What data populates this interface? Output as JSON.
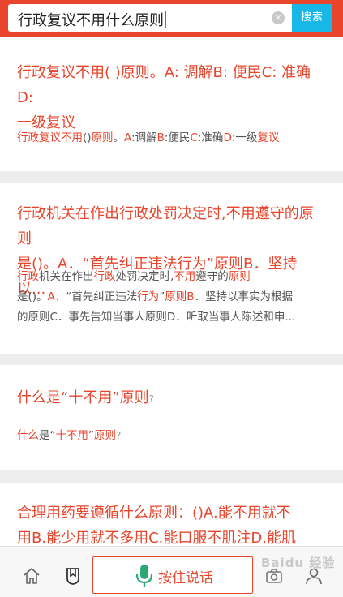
{
  "search": {
    "query": "行政复议不用什么原则",
    "button_label": "搜索",
    "clear_glyph": "×"
  },
  "results": [
    {
      "title_line1": "行政复议不用( )原则。A: 调解B: 便民C: 准确D:",
      "title_line2": "一级复议",
      "snippet": [
        {
          "t": "行政复议不用",
          "h": true
        },
        {
          "t": "()",
          "h": false
        },
        {
          "t": "原则",
          "h": true
        },
        {
          "t": "。",
          "h": false
        },
        {
          "t": "A",
          "h": true
        },
        {
          "t": ":调解",
          "h": false
        },
        {
          "t": "B",
          "h": true
        },
        {
          "t": ":便民",
          "h": false
        },
        {
          "t": "C",
          "h": true
        },
        {
          "t": ":准确",
          "h": false
        },
        {
          "t": "D",
          "h": true
        },
        {
          "t": ":一级",
          "h": false
        },
        {
          "t": "复议",
          "h": true
        }
      ]
    },
    {
      "title_line1": "行政机关在作出行政处罚决定时,不用遵守的原则",
      "title_line2": "是()。A．“首先纠正违法行为”原则B．坚持以...",
      "snippet_line1": [
        {
          "t": "行政",
          "h": true
        },
        {
          "t": "机关在作出",
          "h": false
        },
        {
          "t": "行政",
          "h": true
        },
        {
          "t": "处罚决定时,",
          "h": false
        },
        {
          "t": "不用",
          "h": true
        },
        {
          "t": "遵守的",
          "h": false
        },
        {
          "t": "原则",
          "h": true
        }
      ],
      "snippet_line2": [
        {
          "t": "是()。",
          "h": false
        },
        {
          "t": "A",
          "h": true
        },
        {
          "t": "．“首先纠正违法",
          "h": false
        },
        {
          "t": "行为",
          "h": true
        },
        {
          "t": "”",
          "h": false
        },
        {
          "t": "原则",
          "h": true
        },
        {
          "t": "B",
          "h": true
        },
        {
          "t": "．坚持以事实为根据",
          "h": false
        }
      ],
      "snippet_line3": "的原则C．事先告知当事人原则D．听取当事人陈述和申..."
    },
    {
      "title": "什么是“十不用”原则",
      "title_q": "?",
      "snippet": [
        {
          "t": "什么",
          "h": true
        },
        {
          "t": "是“",
          "h": false
        },
        {
          "t": "十不用",
          "h": true
        },
        {
          "t": "”",
          "h": false
        },
        {
          "t": "原则",
          "h": true
        }
      ],
      "snippet_q": "?"
    },
    {
      "title_line1": "合理用药要遵循什么原则：()A.能不用就不",
      "title_line2": "用B.能少用就不多用C.能口服不肌注D.能肌注..."
    }
  ],
  "bottom_bar": {
    "voice_label": "按住说话",
    "watermark": "Baidu 经验"
  },
  "colors": {
    "brand": "#e8452c",
    "search_button": "#17b7e7",
    "mic": "#2aa876"
  },
  "icons": [
    "home-icon",
    "bookmark-icon",
    "microphone-icon",
    "camera-icon",
    "user-icon"
  ]
}
